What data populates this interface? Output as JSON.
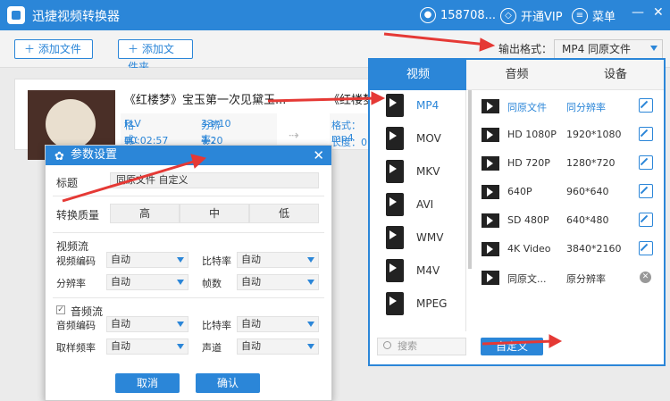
{
  "app": {
    "title": "迅捷视频转换器",
    "user": "158708...",
    "vip": "开通VIP",
    "menu": "菜单"
  },
  "toolbar": {
    "add_file": "添加文件",
    "add_folder": "添加文件夹",
    "output_label": "输出格式：",
    "output_value": "MP4  同原文件"
  },
  "file": {
    "name": "《红楼梦》宝玉第一次见黛玉...",
    "name2": "《红楼梦",
    "format_label": "格式：",
    "format": "FLV",
    "resolution_label": "分辨率：",
    "resolution": "33*10",
    "duration_label": "长度：",
    "duration": "00:02:57",
    "size_label": "大小：",
    "size": "7.20 MB",
    "format2": "格式：mp4",
    "duration2": "长度：0"
  },
  "dialog": {
    "title": "参数设置",
    "title_label": "标题",
    "title_value": "同原文件 自定义",
    "quality_label": "转换质量",
    "quality": [
      "高",
      "中",
      "低"
    ],
    "video_stream": "视频流",
    "video_codec_label": "视频编码",
    "video_codec": "自动",
    "bitrate_label": "比特率",
    "bitrate": "自动",
    "resolution_label": "分辨率",
    "resolution": "自动",
    "fps_label": "帧数",
    "fps": "自动",
    "audio_stream": "音频流",
    "audio_codec_label": "音频编码",
    "audio_codec": "自动",
    "audio_bitrate_label": "比特率",
    "audio_bitrate": "自动",
    "sample_label": "取样频率",
    "sample": "自动",
    "channel_label": "声道",
    "channel": "自动",
    "cancel": "取消",
    "confirm": "确认"
  },
  "panel": {
    "tabs": [
      "视频",
      "音频",
      "设备"
    ],
    "formats": [
      "MP4",
      "MOV",
      "MKV",
      "AVI",
      "WMV",
      "M4V",
      "MPEG"
    ],
    "qualities": [
      {
        "name": "同原文件",
        "res": "同分辨率"
      },
      {
        "name": "HD 1080P",
        "res": "1920*1080"
      },
      {
        "name": "HD 720P",
        "res": "1280*720"
      },
      {
        "name": "640P",
        "res": "960*640"
      },
      {
        "name": "SD 480P",
        "res": "640*480"
      },
      {
        "name": "4K Video",
        "res": "3840*2160"
      },
      {
        "name": "同原文...",
        "res": "原分辨率"
      }
    ],
    "search_placeholder": "搜索",
    "custom": "自定义"
  }
}
